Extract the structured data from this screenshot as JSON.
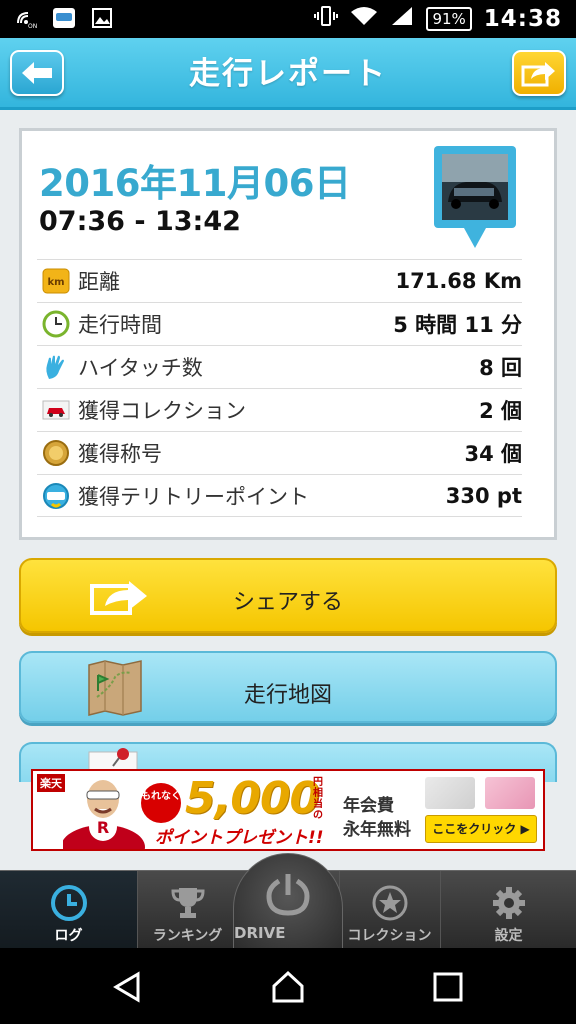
{
  "status_bar": {
    "battery": "91%",
    "time": "14:38"
  },
  "header": {
    "title": "走行レポート"
  },
  "report": {
    "date": "2016年11月06日",
    "time_range": "07:36 - 13:42",
    "stats": [
      {
        "icon": "km-icon",
        "label": "距離",
        "value": "171.68 Km"
      },
      {
        "icon": "clock-icon",
        "label": "走行時間",
        "value": "5 時間 11 分"
      },
      {
        "icon": "hi-touch-hand-icon",
        "label": "ハイタッチ数",
        "value": "8 回"
      },
      {
        "icon": "car-icon",
        "label": "獲得コレクション",
        "value": "2 個"
      },
      {
        "icon": "medal-icon",
        "label": "獲得称号",
        "value": "34 個"
      },
      {
        "icon": "spot-icon",
        "label": "獲得テリトリーポイント",
        "value": "330 pt"
      }
    ]
  },
  "buttons": {
    "share": "シェアする",
    "map": "走行地図"
  },
  "ad": {
    "brand": "楽天",
    "badge": "もれなく",
    "amount": "5,000",
    "unit": "円相当の",
    "subtitle": "ポイントプレゼント!!",
    "fee_line1": "年会費",
    "fee_line2": "永年無料",
    "cta": "ここをクリック ▶"
  },
  "tabs": {
    "log": "ログ",
    "ranking": "ランキング",
    "drive": "DRIVE",
    "collection": "コレクション",
    "settings": "設定"
  },
  "colors": {
    "header": "#3fbfe3",
    "date_text": "#38a9cf",
    "share_button": "#f5c600",
    "map_button": "#8ad9ef",
    "active_tab_icon": "#3ab0e0"
  }
}
